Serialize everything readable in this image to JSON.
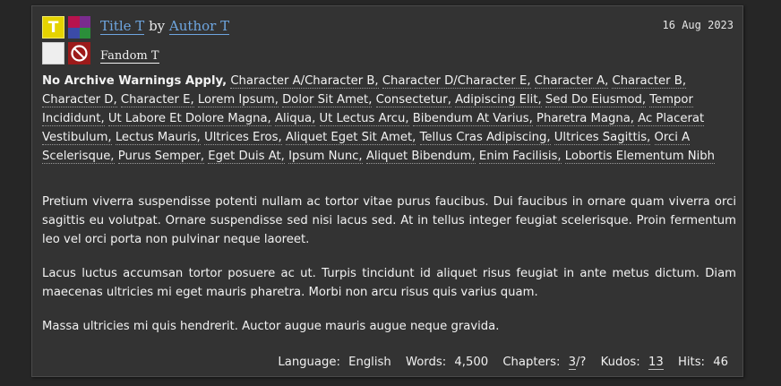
{
  "work": {
    "title": "Title T",
    "by": "by",
    "author": "Author T",
    "fandom": "Fandom T",
    "date": "16 Aug 2023",
    "symbols": {
      "rating_letter": "T",
      "rating_color": "#e5d300",
      "warning_color": "#9c1a1a",
      "category_colors": [
        "#b8134e",
        "#7a2c8e",
        "#3b4ba8",
        "#2b8f3a"
      ],
      "warning_icon": "no-entry-icon"
    },
    "warning": "No Archive Warnings Apply,",
    "tags": [
      "Character A/Character B,",
      "Character D/Character E,",
      "Character A,",
      "Character B,",
      "Character D,",
      "Character E,",
      "Lorem Ipsum,",
      "Dolor Sit Amet,",
      "Consectetur,",
      "Adipiscing Elit,",
      "Sed Do Eiusmod,",
      "Tempor Incididunt,",
      "Ut Labore Et Dolore Magna,",
      "Aliqua,",
      "Ut Lectus Arcu,",
      "Bibendum At Varius,",
      "Pharetra Magna,",
      "Ac Placerat Vestibulum,",
      "Lectus Mauris,",
      "Ultrices Eros,",
      "Aliquet Eget Sit Amet,",
      "Tellus Cras Adipiscing,",
      "Ultrices Sagittis,",
      "Orci A Scelerisque,",
      "Purus Semper,",
      "Eget Duis At,",
      "Ipsum Nunc,",
      "Aliquet Bibendum,",
      "Enim Facilisis,",
      "Lobortis Elementum Nibh"
    ],
    "summary": [
      "Pretium viverra suspendisse potenti nullam ac tortor vitae purus faucibus. Dui faucibus in ornare quam viverra orci sagittis eu volutpat. Ornare suspendisse sed nisi lacus sed. At in tellus integer feugiat scelerisque. Proin fermentum leo vel orci porta non pulvinar neque laoreet.",
      "Lacus luctus accumsan tortor posuere ac ut. Turpis tincidunt id aliquet risus feugiat in ante metus dictum. Diam maecenas ultricies mi eget mauris pharetra. Morbi non arcu risus quis varius quam.",
      "Massa ultricies mi quis hendrerit. Auctor augue mauris augue neque gravida."
    ],
    "stats": {
      "language_label": "Language:",
      "language": "English",
      "words_label": "Words:",
      "words": "4,500",
      "chapters_label": "Chapters:",
      "chapters_posted": "3",
      "chapters_total": "/?",
      "kudos_label": "Kudos:",
      "kudos": "13",
      "hits_label": "Hits:",
      "hits": "46"
    }
  }
}
